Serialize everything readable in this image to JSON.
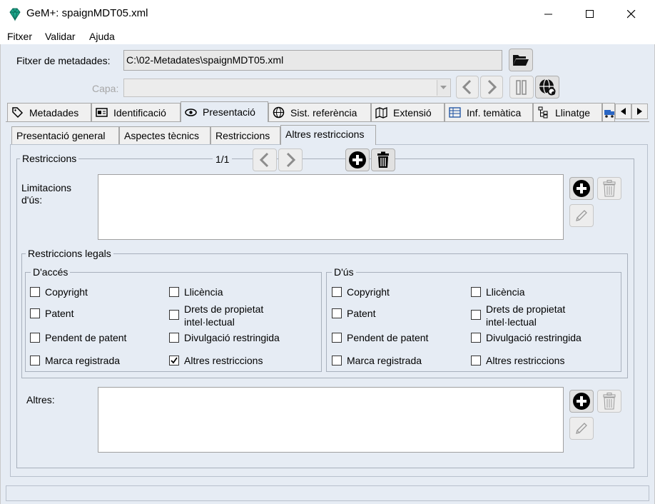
{
  "window": {
    "title": "GeM+: spaignMDT05.xml",
    "minimize": "–",
    "maximize": "☐",
    "close": "✕"
  },
  "menu": [
    "Fitxer",
    "Validar",
    "Ajuda"
  ],
  "file_row": {
    "label": "Fitxer de metadades:",
    "value": "C:\\02-Metadates\\spaignMDT05.xml"
  },
  "layer_row": {
    "label": "Capa:",
    "value": ""
  },
  "tabs": [
    {
      "label": "Metadades",
      "icon": "tag-icon"
    },
    {
      "label": "Identificació",
      "icon": "id-card-icon"
    },
    {
      "label": "Presentació",
      "icon": "eye-icon",
      "active": true
    },
    {
      "label": "Sist. referència",
      "icon": "globe-icon"
    },
    {
      "label": "Extensió",
      "icon": "map-icon"
    },
    {
      "label": "Inf. temàtica",
      "icon": "table-icon"
    },
    {
      "label": "Llinatge",
      "icon": "tree-icon"
    }
  ],
  "subtabs": [
    {
      "label": "Presentació general"
    },
    {
      "label": "Aspectes tècnics"
    },
    {
      "label": "Restriccions"
    },
    {
      "label": "Altres restriccions",
      "active": true
    }
  ],
  "restriccions": {
    "legend": "Restriccions",
    "counter": "1/1",
    "limitacions_label_1": "Limitacions",
    "limitacions_label_2": "d'ús:",
    "legals_legend": "Restriccions legals",
    "acces_legend": "D'accés",
    "us_legend": "D'ús",
    "altres_label": "Altres:"
  },
  "acces_checks": [
    {
      "label": "Copyright",
      "checked": false
    },
    {
      "label": "Llicència",
      "checked": false
    },
    {
      "label": "Patent",
      "checked": false
    },
    {
      "label": "Drets de propietat",
      "label2": "intel·lectual",
      "checked": false
    },
    {
      "label": "Pendent de patent",
      "checked": false
    },
    {
      "label": "Divulgació restringida",
      "checked": false
    },
    {
      "label": "Marca registrada",
      "checked": false
    },
    {
      "label": "Altres restriccions",
      "checked": true
    }
  ],
  "us_checks": [
    {
      "label": "Copyright",
      "checked": false
    },
    {
      "label": "Llicència",
      "checked": false
    },
    {
      "label": "Patent",
      "checked": false
    },
    {
      "label": "Drets de propietat",
      "label2": "intel·lectual",
      "checked": false
    },
    {
      "label": "Pendent de patent",
      "checked": false
    },
    {
      "label": "Divulgació restringida",
      "checked": false
    },
    {
      "label": "Marca registrada",
      "checked": false
    },
    {
      "label": "Altres restriccions",
      "checked": false
    }
  ]
}
